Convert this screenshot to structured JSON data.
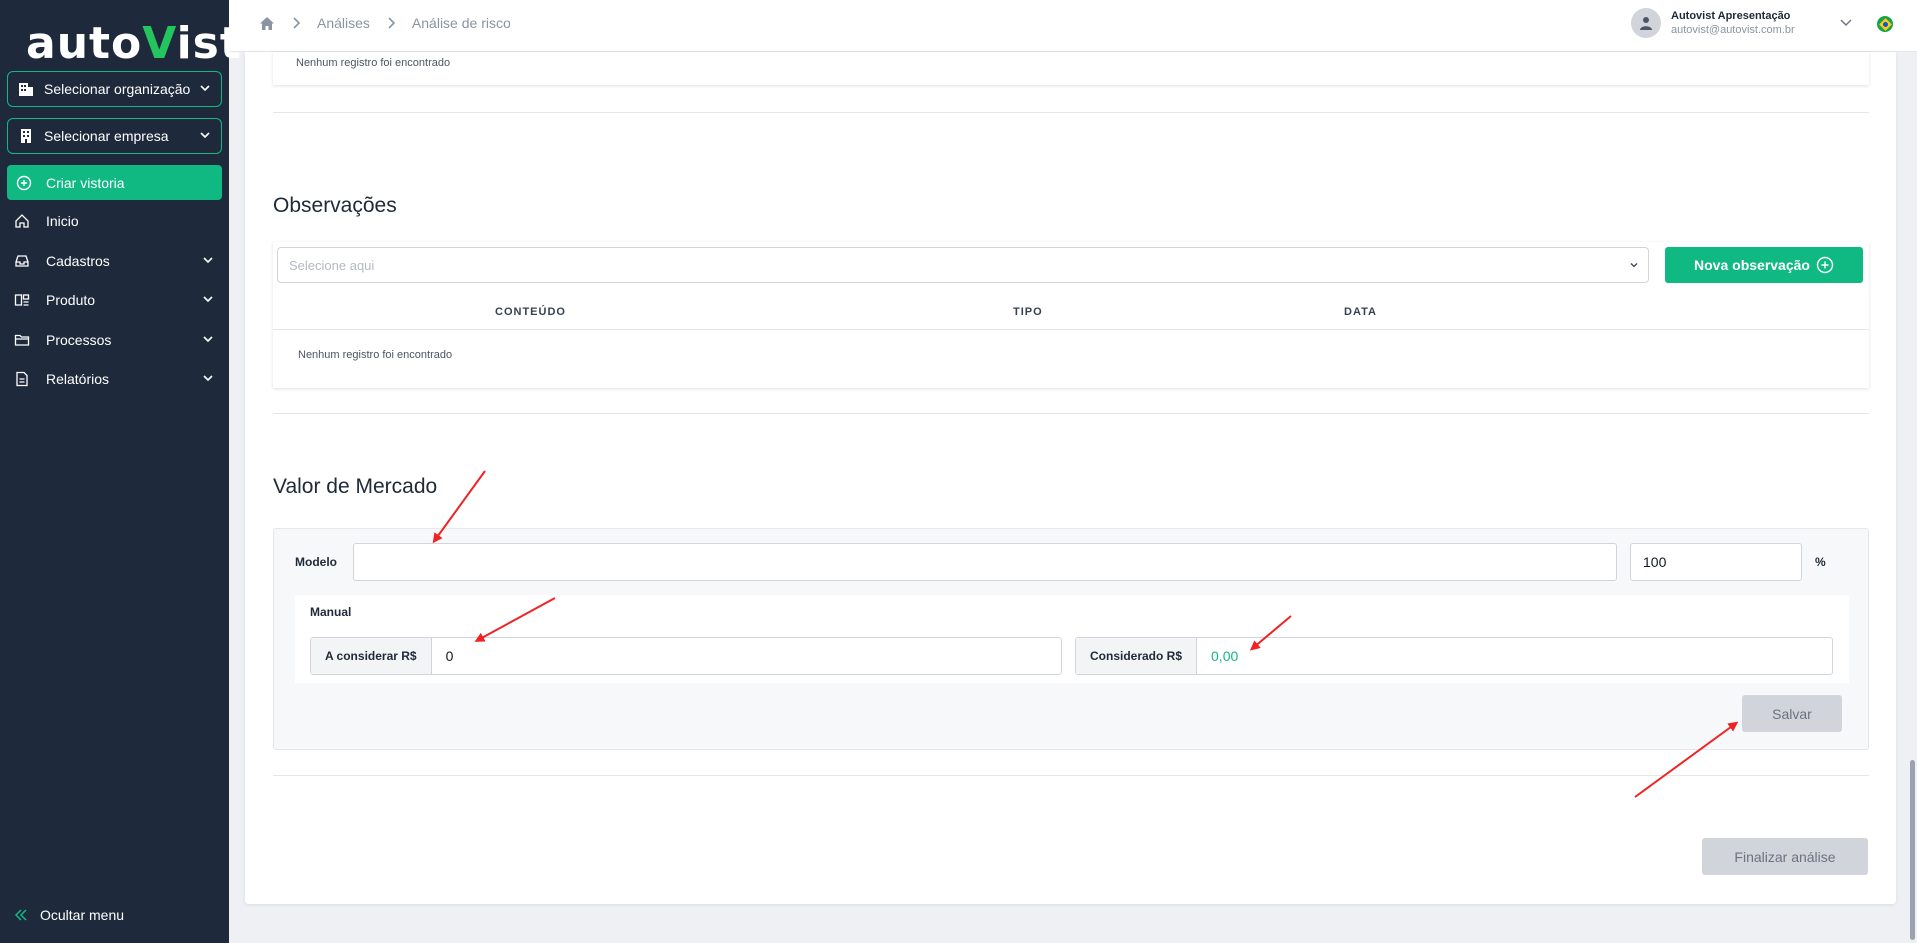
{
  "sidebar": {
    "logo_left": "auto",
    "logo_v": "V",
    "logo_right": "ist",
    "org_selector": "Selecionar organização",
    "company_selector": "Selecionar empresa",
    "create_label": "Criar vistoria",
    "items": [
      {
        "label": "Inicio",
        "icon": "home-icon"
      },
      {
        "label": "Cadastros",
        "icon": "inbox-icon"
      },
      {
        "label": "Produto",
        "icon": "product-icon"
      },
      {
        "label": "Processos",
        "icon": "folder-icon"
      },
      {
        "label": "Relatórios",
        "icon": "report-icon"
      }
    ],
    "hide_menu": "Ocultar menu"
  },
  "header": {
    "breadcrumb": [
      "Análises",
      "Análise de risco"
    ],
    "user_name": "Autovist Apresentação",
    "user_email": "autovist@autovist.com.br"
  },
  "top_panel": {
    "empty": "Nenhum registro foi encontrado"
  },
  "observacoes": {
    "title": "Observações",
    "select_placeholder": "Selecione aqui",
    "new_button": "Nova observação",
    "columns": [
      "CONTEÚDO",
      "TIPO",
      "DATA"
    ],
    "empty": "Nenhum registro foi encontrado"
  },
  "valor_mercado": {
    "title": "Valor de Mercado",
    "modelo_label": "Modelo",
    "modelo_value": "",
    "percent_value": "100",
    "percent_symbol": "%",
    "manual_title": "Manual",
    "a_considerar_label": "A considerar R$",
    "a_considerar_value": "0",
    "considerado_label": "Considerado R$",
    "considerado_value": "0,00",
    "save_button": "Salvar"
  },
  "finalize_button": "Finalizar análise",
  "colors": {
    "sidebar_bg": "#1e2a3b",
    "accent": "#10b981",
    "disabled_btn": "#d1d5db",
    "annotation_arrow": "#ef2323"
  }
}
